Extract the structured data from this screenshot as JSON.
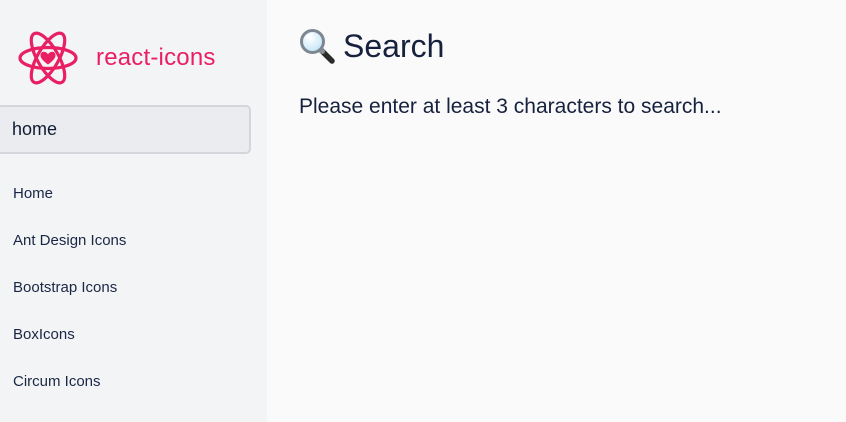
{
  "brand": {
    "name": "react-icons",
    "logo_icon": "react-atom-heart-logo",
    "color": "#e91e63"
  },
  "search": {
    "value": "home"
  },
  "sidebar": {
    "items": [
      {
        "label": "Home"
      },
      {
        "label": "Ant Design Icons"
      },
      {
        "label": "Bootstrap Icons"
      },
      {
        "label": "BoxIcons"
      },
      {
        "label": "Circum Icons"
      }
    ]
  },
  "main": {
    "title_icon": "magnifying-glass-icon",
    "title": "Search",
    "message": "Please enter at least 3 characters to search..."
  }
}
